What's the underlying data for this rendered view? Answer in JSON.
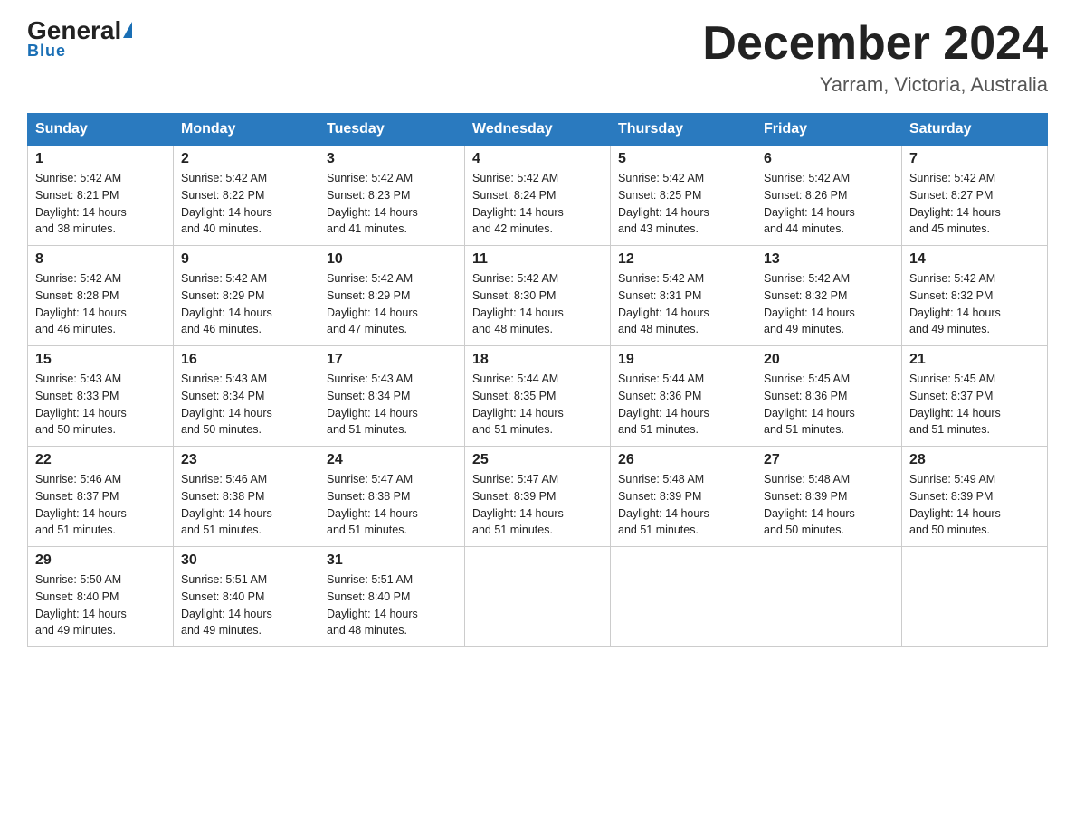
{
  "logo": {
    "general": "General",
    "blue": "Blue"
  },
  "header": {
    "month_year": "December 2024",
    "location": "Yarram, Victoria, Australia"
  },
  "days_of_week": [
    "Sunday",
    "Monday",
    "Tuesday",
    "Wednesday",
    "Thursday",
    "Friday",
    "Saturday"
  ],
  "weeks": [
    [
      {
        "day": "1",
        "sunrise": "5:42 AM",
        "sunset": "8:21 PM",
        "daylight": "14 hours and 38 minutes."
      },
      {
        "day": "2",
        "sunrise": "5:42 AM",
        "sunset": "8:22 PM",
        "daylight": "14 hours and 40 minutes."
      },
      {
        "day": "3",
        "sunrise": "5:42 AM",
        "sunset": "8:23 PM",
        "daylight": "14 hours and 41 minutes."
      },
      {
        "day": "4",
        "sunrise": "5:42 AM",
        "sunset": "8:24 PM",
        "daylight": "14 hours and 42 minutes."
      },
      {
        "day": "5",
        "sunrise": "5:42 AM",
        "sunset": "8:25 PM",
        "daylight": "14 hours and 43 minutes."
      },
      {
        "day": "6",
        "sunrise": "5:42 AM",
        "sunset": "8:26 PM",
        "daylight": "14 hours and 44 minutes."
      },
      {
        "day": "7",
        "sunrise": "5:42 AM",
        "sunset": "8:27 PM",
        "daylight": "14 hours and 45 minutes."
      }
    ],
    [
      {
        "day": "8",
        "sunrise": "5:42 AM",
        "sunset": "8:28 PM",
        "daylight": "14 hours and 46 minutes."
      },
      {
        "day": "9",
        "sunrise": "5:42 AM",
        "sunset": "8:29 PM",
        "daylight": "14 hours and 46 minutes."
      },
      {
        "day": "10",
        "sunrise": "5:42 AM",
        "sunset": "8:29 PM",
        "daylight": "14 hours and 47 minutes."
      },
      {
        "day": "11",
        "sunrise": "5:42 AM",
        "sunset": "8:30 PM",
        "daylight": "14 hours and 48 minutes."
      },
      {
        "day": "12",
        "sunrise": "5:42 AM",
        "sunset": "8:31 PM",
        "daylight": "14 hours and 48 minutes."
      },
      {
        "day": "13",
        "sunrise": "5:42 AM",
        "sunset": "8:32 PM",
        "daylight": "14 hours and 49 minutes."
      },
      {
        "day": "14",
        "sunrise": "5:42 AM",
        "sunset": "8:32 PM",
        "daylight": "14 hours and 49 minutes."
      }
    ],
    [
      {
        "day": "15",
        "sunrise": "5:43 AM",
        "sunset": "8:33 PM",
        "daylight": "14 hours and 50 minutes."
      },
      {
        "day": "16",
        "sunrise": "5:43 AM",
        "sunset": "8:34 PM",
        "daylight": "14 hours and 50 minutes."
      },
      {
        "day": "17",
        "sunrise": "5:43 AM",
        "sunset": "8:34 PM",
        "daylight": "14 hours and 51 minutes."
      },
      {
        "day": "18",
        "sunrise": "5:44 AM",
        "sunset": "8:35 PM",
        "daylight": "14 hours and 51 minutes."
      },
      {
        "day": "19",
        "sunrise": "5:44 AM",
        "sunset": "8:36 PM",
        "daylight": "14 hours and 51 minutes."
      },
      {
        "day": "20",
        "sunrise": "5:45 AM",
        "sunset": "8:36 PM",
        "daylight": "14 hours and 51 minutes."
      },
      {
        "day": "21",
        "sunrise": "5:45 AM",
        "sunset": "8:37 PM",
        "daylight": "14 hours and 51 minutes."
      }
    ],
    [
      {
        "day": "22",
        "sunrise": "5:46 AM",
        "sunset": "8:37 PM",
        "daylight": "14 hours and 51 minutes."
      },
      {
        "day": "23",
        "sunrise": "5:46 AM",
        "sunset": "8:38 PM",
        "daylight": "14 hours and 51 minutes."
      },
      {
        "day": "24",
        "sunrise": "5:47 AM",
        "sunset": "8:38 PM",
        "daylight": "14 hours and 51 minutes."
      },
      {
        "day": "25",
        "sunrise": "5:47 AM",
        "sunset": "8:39 PM",
        "daylight": "14 hours and 51 minutes."
      },
      {
        "day": "26",
        "sunrise": "5:48 AM",
        "sunset": "8:39 PM",
        "daylight": "14 hours and 51 minutes."
      },
      {
        "day": "27",
        "sunrise": "5:48 AM",
        "sunset": "8:39 PM",
        "daylight": "14 hours and 50 minutes."
      },
      {
        "day": "28",
        "sunrise": "5:49 AM",
        "sunset": "8:39 PM",
        "daylight": "14 hours and 50 minutes."
      }
    ],
    [
      {
        "day": "29",
        "sunrise": "5:50 AM",
        "sunset": "8:40 PM",
        "daylight": "14 hours and 49 minutes."
      },
      {
        "day": "30",
        "sunrise": "5:51 AM",
        "sunset": "8:40 PM",
        "daylight": "14 hours and 49 minutes."
      },
      {
        "day": "31",
        "sunrise": "5:51 AM",
        "sunset": "8:40 PM",
        "daylight": "14 hours and 48 minutes."
      },
      null,
      null,
      null,
      null
    ]
  ],
  "labels": {
    "sunrise": "Sunrise:",
    "sunset": "Sunset:",
    "daylight": "Daylight:"
  }
}
